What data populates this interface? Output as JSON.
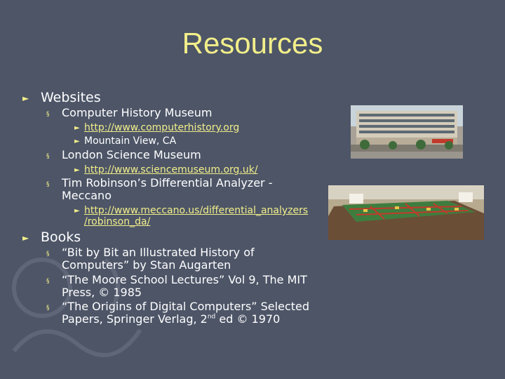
{
  "title": "Resources",
  "websites": {
    "label": "Websites",
    "chm": {
      "label": "Computer History Museum",
      "link": "http://www.computerhistory.org",
      "location": "Mountain View, CA"
    },
    "lsm": {
      "label": "London Science Museum",
      "link": "http://www.sciencemuseum.org.uk/"
    },
    "meccano": {
      "label_line1": "Tim Robinson’s Differential Analyzer -",
      "label_line2": "Meccano",
      "link_line1": "http://www.meccano.us/differential_analyzers",
      "link_line2": "/robinson_da/"
    }
  },
  "books": {
    "label": "Books",
    "b1_line1": "“Bit by Bit an Illustrated History of",
    "b1_line2": "Computers” by Stan Augarten",
    "b2_line1": "“The Moore School Lectures” Vol 9, The MIT",
    "b2_line2": "Press, © 1985",
    "b3_line1": "“The Origins of Digital Computers” Selected",
    "b3_line2_a": "Papers, Springer Verlag, 2",
    "b3_line2_sup": "nd",
    "b3_line2_b": " ed © 1970"
  },
  "bullets": {
    "level1": "►",
    "level2": "§",
    "level3": "►"
  },
  "icons": {
    "arrow": "arrow-right-icon",
    "square": "square-bullet-icon"
  },
  "colors": {
    "background": "#4d5567",
    "accent": "#f2ee8a",
    "text": "#ffffff"
  }
}
